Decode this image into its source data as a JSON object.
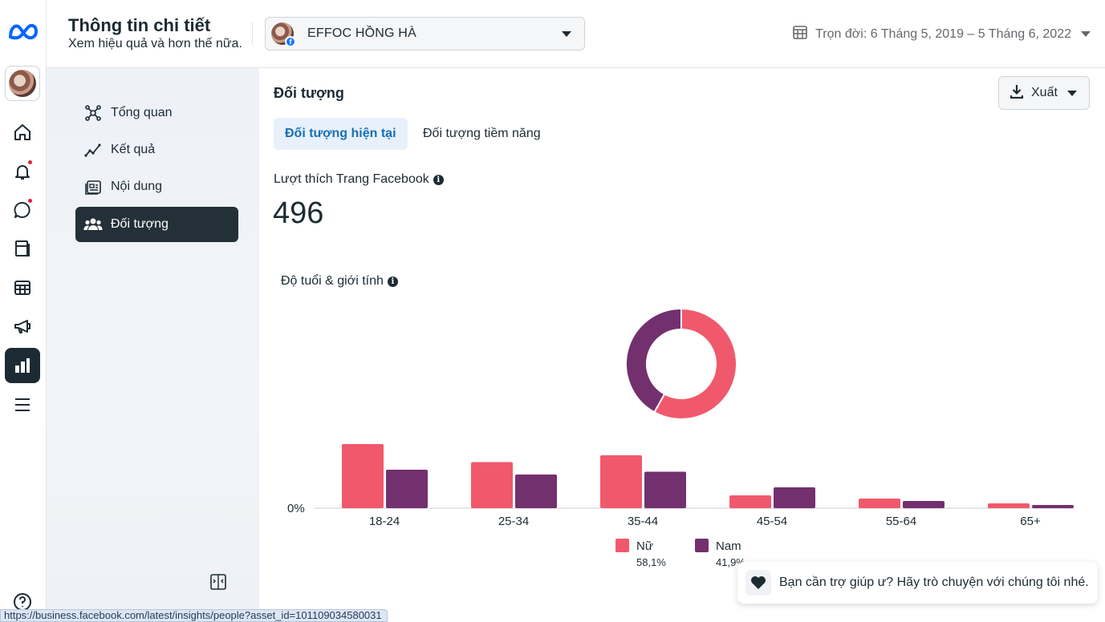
{
  "header": {
    "title": "Thông tin chi tiết",
    "subtitle": "Xem hiệu quả và hơn thế nữa.",
    "page_select": {
      "name": "EFFOC HỒNG HÀ",
      "icon": "page-avatar"
    },
    "date_range": "Trọn đời: 6 Tháng 5, 2019 – 5 Tháng 6, 2022"
  },
  "rail": {
    "icons": [
      "meta-logo-icon",
      "page-avatar",
      "home-icon",
      "bell-icon",
      "chat-icon",
      "pages-icon",
      "table-icon",
      "megaphone-icon",
      "insights-chart-icon",
      "menu-icon",
      "help-icon"
    ],
    "notification_color": "#e41e3f"
  },
  "sidebar": {
    "items": [
      {
        "label": "Tổng quan",
        "icon": "overview-icon",
        "active": false
      },
      {
        "label": "Kết quả",
        "icon": "results-icon",
        "active": false
      },
      {
        "label": "Nội dung",
        "icon": "content-icon",
        "active": false
      },
      {
        "label": "Đối tượng",
        "icon": "audience-icon",
        "active": true
      }
    ]
  },
  "main": {
    "section_title": "Đối tượng",
    "export_label": "Xuất",
    "tabs": [
      {
        "label": "Đối tượng hiện tại",
        "active": true
      },
      {
        "label": "Đối tượng tiềm năng",
        "active": false
      }
    ],
    "likes_label": "Lượt thích Trang Facebook",
    "likes_value": "496",
    "age_gender_label": "Độ tuổi & giới tính"
  },
  "chart_data": {
    "type": "bar",
    "categories": [
      "18-24",
      "25-34",
      "35-44",
      "45-54",
      "55-64",
      "65+"
    ],
    "series": [
      {
        "name": "Nữ",
        "share": "58,1%",
        "color": "#f0596b",
        "values": [
          16,
          11.5,
          13.2,
          3.2,
          2.4,
          1.2
        ]
      },
      {
        "name": "Nam",
        "share": "41,9%",
        "color": "#73306e",
        "values": [
          9.6,
          8.4,
          9.1,
          5.2,
          1.8,
          0.8
        ]
      }
    ],
    "donut": {
      "values": [
        58.1,
        41.9
      ],
      "colors": [
        "#f0596b",
        "#73306e"
      ]
    },
    "ylabel_tick": "0%",
    "ylim": [
      0,
      18
    ]
  },
  "help": {
    "text": "Bạn cần trợ giúp ư? Hãy trò chuyện với chúng tôi nhé."
  },
  "status_url": "https://business.facebook.com/latest/insights/people?asset_id=101109034580031"
}
